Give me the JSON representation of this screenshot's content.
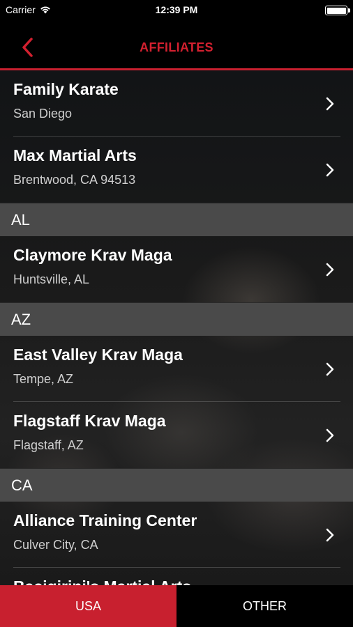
{
  "status": {
    "carrier": "Carrier",
    "time": "12:39 PM"
  },
  "nav": {
    "title": "AFFILIATES",
    "accent": "#c8202f"
  },
  "list": {
    "items_top": [
      {
        "name": "Family Karate",
        "location": "San Diego"
      },
      {
        "name": "Max Martial Arts",
        "location": "Brentwood, CA 94513"
      }
    ],
    "sections": [
      {
        "label": "AL",
        "items": [
          {
            "name": "Claymore Krav Maga",
            "location": "Huntsville, AL"
          }
        ]
      },
      {
        "label": "AZ",
        "items": [
          {
            "name": "East Valley Krav Maga",
            "location": "Tempe, AZ"
          },
          {
            "name": "Flagstaff Krav Maga",
            "location": "Flagstaff, AZ"
          }
        ]
      },
      {
        "label": "CA",
        "items": [
          {
            "name": "Alliance Training Center",
            "location": "Culver City, CA"
          },
          {
            "name": "Bacigirini's Martial Arts",
            "location": ""
          }
        ]
      }
    ]
  },
  "tabs": {
    "usa": "USA",
    "other": "OTHER"
  }
}
